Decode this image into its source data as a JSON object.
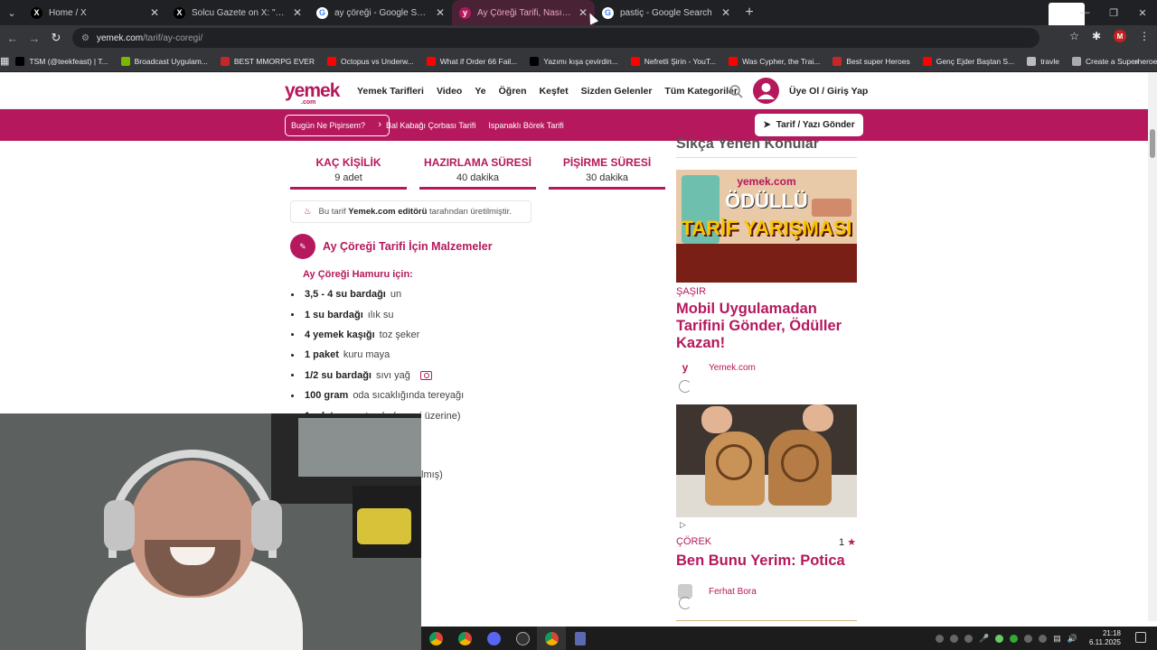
{
  "browser": {
    "tabs": [
      {
        "title": "Home / X",
        "icon": "x-logo-icon",
        "active": false
      },
      {
        "title": "Solcu Gazete on X: \"Bir şahıs, Ya",
        "icon": "x-logo-icon",
        "active": false
      },
      {
        "title": "ay çöreği - Google Search",
        "icon": "google-icon",
        "active": false
      },
      {
        "title": "Ay Çöreği Tarifi, Nasıl Yapılır? (R",
        "icon": "yemek-icon",
        "active": true
      },
      {
        "title": "pastiç - Google Search",
        "icon": "google-icon",
        "active": false
      }
    ],
    "new_tab": "+",
    "url_domain": "yemek.com",
    "url_path": "/tarif/ay-coregi/",
    "profile_initial": "M",
    "bookmarks": [
      {
        "label": "TSM (@teekfeast) | T...",
        "icon": "tiktok-icon"
      },
      {
        "label": "Broadcast Uygulam...",
        "icon": "nvidia-icon"
      },
      {
        "label": "BEST MMORPG EVER",
        "icon": "u-icon"
      },
      {
        "label": "Octopus vs Underw...",
        "icon": "youtube-icon"
      },
      {
        "label": "What if Order 66 Fail...",
        "icon": "youtube-icon"
      },
      {
        "label": "Yazımı kışa çevirdin...",
        "icon": "tiktok-icon"
      },
      {
        "label": "Nefretli Şirin - YouT...",
        "icon": "youtube-icon"
      },
      {
        "label": "Was Cypher, the Trai...",
        "icon": "youtube-icon"
      },
      {
        "label": "Best super Heroes",
        "icon": "u-icon"
      },
      {
        "label": "Genç Ejder Baştan S...",
        "icon": "youtube-icon"
      },
      {
        "label": "travle",
        "icon": "compass-icon"
      },
      {
        "label": "Create a Superheroe...",
        "icon": "page-icon"
      }
    ],
    "bookmarks_more": "»"
  },
  "site": {
    "logo": "yemek",
    "logo_sub": ".com",
    "nav": [
      "Yemek Tarifleri",
      "Video",
      "Ye",
      "Öğren",
      "Keşfet",
      "Sizden Gelenler",
      "Tüm Kategoriler"
    ],
    "login": "Üye Ol / Giriş Yap",
    "today_btn": "Bugün Ne Pişirsem?",
    "sublinks": [
      "Bal Kabağı Çorbası Tarifi",
      "Ispanaklı Börek Tarifi"
    ],
    "send_btn": "Tarif / Yazı Gönder"
  },
  "recipe": {
    "stats": [
      {
        "label": "KAÇ KİŞİLİK",
        "value": "9 adet"
      },
      {
        "label": "HAZIRLAMA SÜRESİ",
        "value": "40 dakika"
      },
      {
        "label": "PİŞİRME SÜRESİ",
        "value": "30 dakika"
      }
    ],
    "editor_note_pre": "Bu tarif",
    "editor_note_bold": "Yemek.com editörü",
    "editor_note_post": "tarafından üretilmiştir.",
    "ingredients_title": "Ay Çöreği Tarifi İçin Malzemeler",
    "group_title": "Ay Çöreği Hamuru için:",
    "ingredients": [
      {
        "amount": "3,5 - 4 su bardağı",
        "item": "un"
      },
      {
        "amount": "1 su bardağı",
        "item": "ılık su"
      },
      {
        "amount": "4 yemek kaşığı",
        "item": "toz şeker"
      },
      {
        "amount": "1 paket",
        "item": "kuru maya"
      },
      {
        "amount": "1/2 su bardağı",
        "item": "sıvı yağ"
      },
      {
        "amount": "100 gram",
        "item": "oda sıcaklığında tereyağı"
      },
      {
        "amount": "1 adet",
        "item": "yumurta akı (çeşmi üzerine)"
      }
    ],
    "trailing_text": "lmış)"
  },
  "sidebar": {
    "title": "Sıkça Yenen Konular",
    "card1": {
      "img_brand": "yemek.com",
      "img_line1": "ÖDÜLLÜ",
      "img_line2": "TARİF YARIŞMASI",
      "category": "ŞAŞIR",
      "title": "Mobil Uygulamadan Tarifini Gönder, Ödüller Kazan!",
      "author": "Yemek.com"
    },
    "card2": {
      "category": "ÇÖREK",
      "rating": "1",
      "title": "Ben Bunu Yerim: Potica",
      "author": "Ferhat Bora"
    }
  },
  "taskbar": {
    "time": "21:18",
    "date": "6.11.2025"
  },
  "colors": {
    "brand": "#b5185c"
  }
}
